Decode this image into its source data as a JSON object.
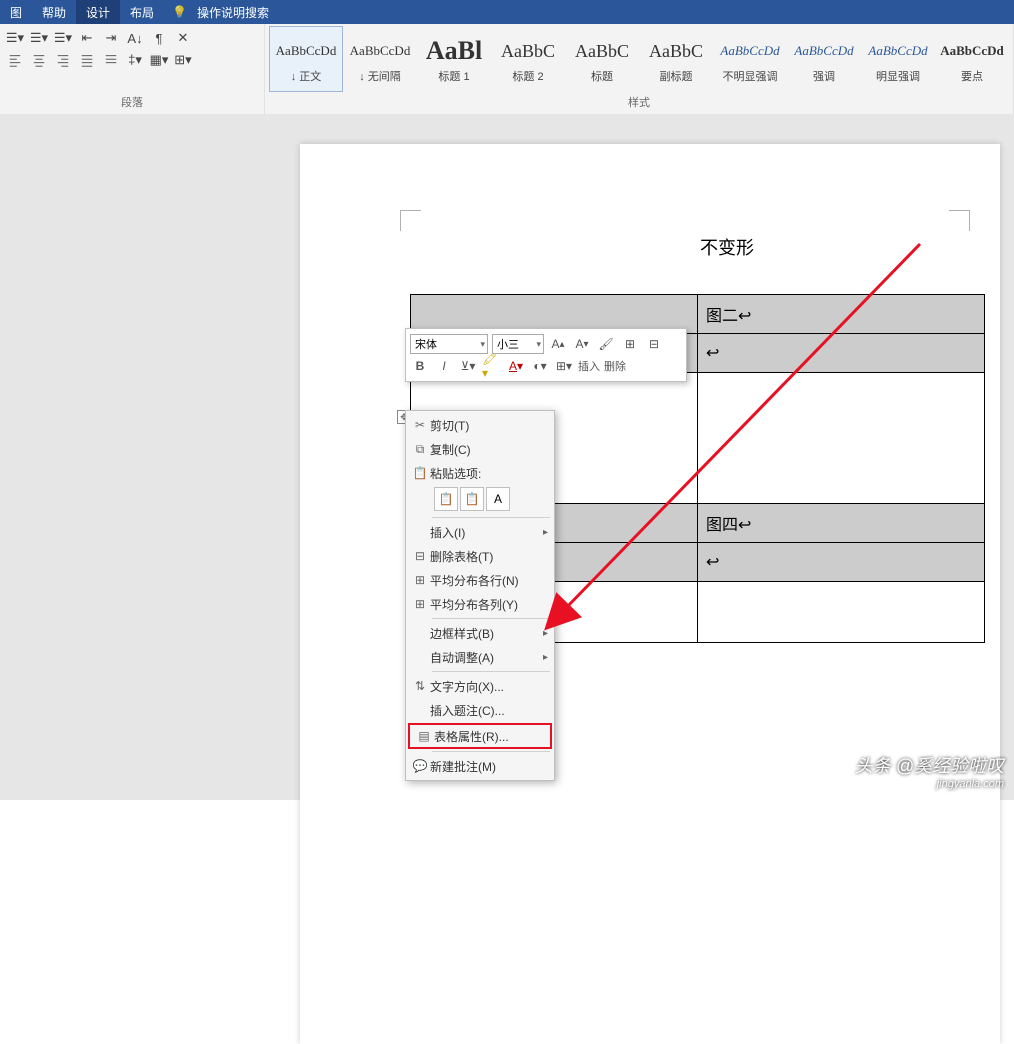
{
  "titlebar": {
    "tabs": [
      "图",
      "帮助",
      "设计",
      "布局"
    ],
    "search": "操作说明搜索"
  },
  "ribbon": {
    "paragraph_label": "段落",
    "styles_label": "样式",
    "styles": [
      {
        "preview": "AaBbCcDd",
        "name": "↓ 正文",
        "sel": true
      },
      {
        "preview": "AaBbCcDd",
        "name": "↓ 无间隔"
      },
      {
        "preview": "AaBl",
        "name": "标题 1",
        "big": true
      },
      {
        "preview": "AaBbC",
        "name": "标题 2"
      },
      {
        "preview": "AaBbC",
        "name": "标题"
      },
      {
        "preview": "AaBbC",
        "name": "副标题"
      },
      {
        "preview": "AaBbCcDd",
        "name": "不明显强调",
        "italic": true
      },
      {
        "preview": "AaBbCcDd",
        "name": "强调",
        "italic": true
      },
      {
        "preview": "AaBbCcDd",
        "name": "明显强调",
        "italic": true
      },
      {
        "preview": "AaBbCcDd",
        "name": "要点"
      }
    ]
  },
  "minitoolbar": {
    "font": "宋体",
    "size": "小三",
    "insert": "插入",
    "delete": "删除"
  },
  "document": {
    "text_fragment": "不变形",
    "cells": {
      "c2": "图二↩",
      "c4": "图四↩",
      "ph": "↩"
    }
  },
  "context_menu": {
    "cut": "剪切(T)",
    "copy": "复制(C)",
    "paste_opts": "粘贴选项:",
    "insert": "插入(I)",
    "delete_table": "删除表格(T)",
    "dist_rows": "平均分布各行(N)",
    "dist_cols": "平均分布各列(Y)",
    "border_style": "边框样式(B)",
    "autofit": "自动调整(A)",
    "text_dir": "文字方向(X)...",
    "caption": "插入题注(C)...",
    "props": "表格属性(R)...",
    "new_comment": "新建批注(M)"
  },
  "watermark": {
    "line1": "头条 @奚经验啦叹",
    "line2": "jingyanla.com"
  }
}
